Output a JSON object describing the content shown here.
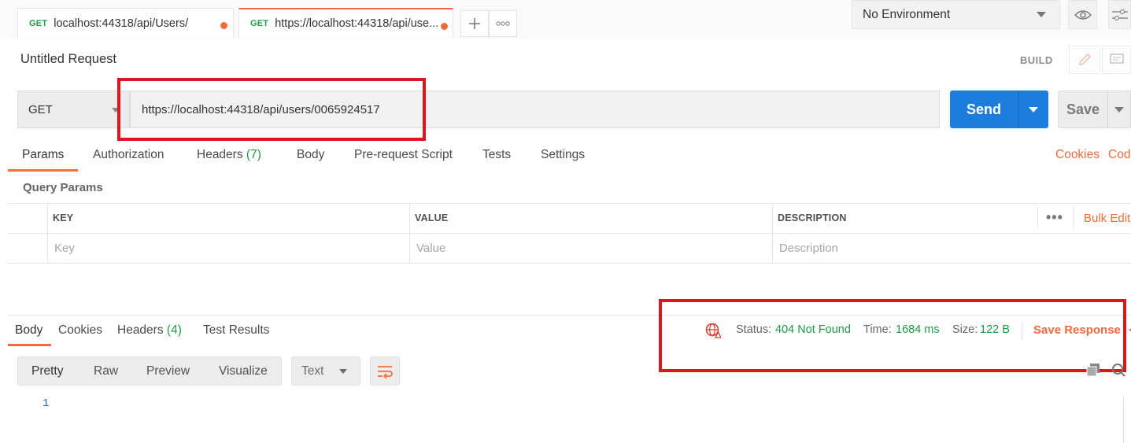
{
  "tabs": [
    {
      "method": "GET",
      "label": "localhost:44318/api/Users/"
    },
    {
      "method": "GET",
      "label": "https://localhost:44318/api/use..."
    }
  ],
  "environment": {
    "selected": "No Environment"
  },
  "request": {
    "title": "Untitled Request",
    "mode": "BUILD",
    "method": "GET",
    "url": "https://localhost:44318/api/users/0065924517",
    "send_label": "Send",
    "save_label": "Save"
  },
  "request_tabs": {
    "params": "Params",
    "authorization": "Authorization",
    "headers": "Headers",
    "headers_count": "(7)",
    "body": "Body",
    "prerequest": "Pre-request Script",
    "tests": "Tests",
    "settings": "Settings",
    "cookies": "Cookies",
    "code": "Code"
  },
  "query_params": {
    "title": "Query Params",
    "columns": [
      "KEY",
      "VALUE",
      "DESCRIPTION"
    ],
    "placeholders": [
      "Key",
      "Value",
      "Description"
    ],
    "bulk_edit": "Bulk Edit",
    "more": "•••"
  },
  "response": {
    "tabs": {
      "body": "Body",
      "cookies": "Cookies",
      "headers": "Headers",
      "headers_count": "(4)",
      "test_results": "Test Results"
    },
    "status_label": "Status:",
    "status_value": "404 Not Found",
    "time_label": "Time:",
    "time_value": "1684 ms",
    "size_label": "Size:",
    "size_value": "122 B",
    "save_response": "Save Response",
    "formats": [
      "Pretty",
      "Raw",
      "Preview",
      "Visualize"
    ],
    "text_type": "Text",
    "line_number": "1"
  },
  "colors": {
    "accent": "#f26b3a",
    "send": "#1c7ddc",
    "success": "#1d9a43",
    "highlight": "#e0141e"
  },
  "icons": [
    "plus-icon",
    "more-icon",
    "eye-icon",
    "sliders-icon",
    "edit-icon",
    "comment-icon",
    "globe-warning-icon",
    "wrap-icon",
    "copy-icon",
    "search-icon"
  ]
}
